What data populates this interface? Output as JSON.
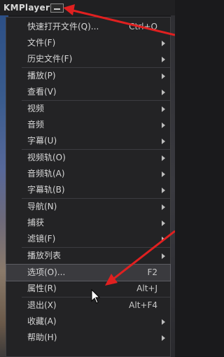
{
  "app": {
    "title": "KMPlayer"
  },
  "menu": {
    "items": [
      {
        "label": "快速打开文件(Q)...",
        "shortcut": "Ctrl+O",
        "submenu": false
      },
      {
        "label": "文件(F)",
        "shortcut": "",
        "submenu": true
      },
      {
        "label": "历史文件(F)",
        "shortcut": "",
        "submenu": true
      },
      {
        "separator": true
      },
      {
        "label": "播放(P)",
        "shortcut": "",
        "submenu": true
      },
      {
        "label": "查看(V)",
        "shortcut": "",
        "submenu": true
      },
      {
        "separator": true
      },
      {
        "label": "视频",
        "shortcut": "",
        "submenu": true
      },
      {
        "label": "音频",
        "shortcut": "",
        "submenu": true
      },
      {
        "label": "字幕(U)",
        "shortcut": "",
        "submenu": true
      },
      {
        "separator": true
      },
      {
        "label": "视频轨(O)",
        "shortcut": "",
        "submenu": true
      },
      {
        "label": "音频轨(A)",
        "shortcut": "",
        "submenu": true
      },
      {
        "label": "字幕轨(B)",
        "shortcut": "",
        "submenu": true
      },
      {
        "separator": true
      },
      {
        "label": "导航(N)",
        "shortcut": "",
        "submenu": true
      },
      {
        "label": "捕获",
        "shortcut": "",
        "submenu": true
      },
      {
        "label": "滤镜(F)",
        "shortcut": "",
        "submenu": true
      },
      {
        "separator": true
      },
      {
        "label": "播放列表",
        "shortcut": "",
        "submenu": true
      },
      {
        "separator": true
      },
      {
        "label": "选项(O)...",
        "shortcut": "F2",
        "submenu": false,
        "highlighted": true
      },
      {
        "label": "属性(R)",
        "shortcut": "Alt+J",
        "submenu": false
      },
      {
        "separator": true
      },
      {
        "label": "退出(X)",
        "shortcut": "Alt+F4",
        "submenu": false
      },
      {
        "label": "收藏(A)",
        "shortcut": "",
        "submenu": true
      },
      {
        "label": "帮助(H)",
        "shortcut": "",
        "submenu": true
      }
    ]
  },
  "colors": {
    "annotation_arrow": "#e02020",
    "menu_bg": "#232325",
    "highlight_bg": "#3a3a3e"
  }
}
